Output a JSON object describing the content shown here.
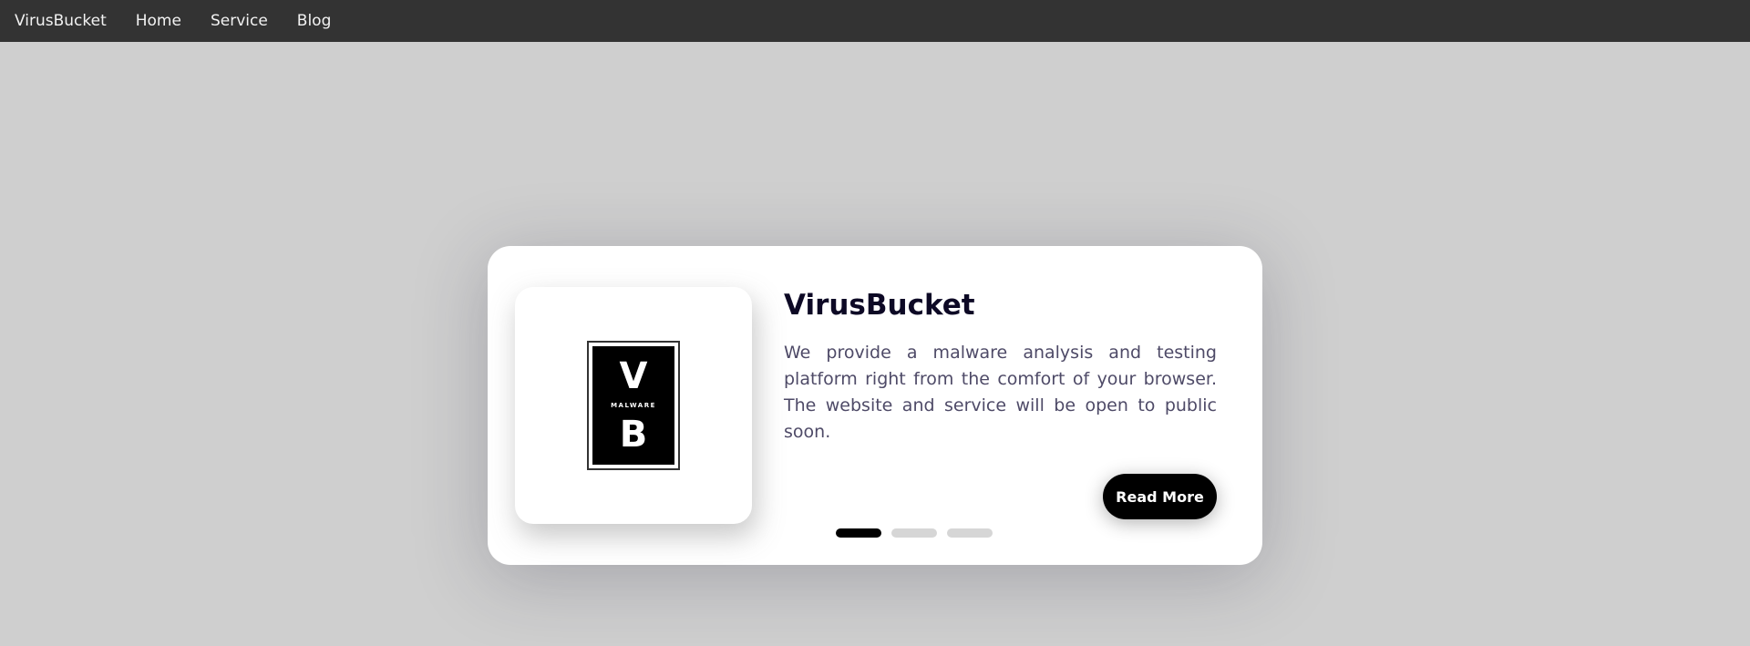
{
  "nav": {
    "items": [
      {
        "label": "VirusBucket"
      },
      {
        "label": "Home"
      },
      {
        "label": "Service"
      },
      {
        "label": "Blog"
      }
    ]
  },
  "slide": {
    "logo": {
      "letter_top": "V",
      "word": "MALWARE",
      "letter_bottom": "B"
    },
    "title": "VirusBucket",
    "text": "We provide a malware analysis and testing platform right from the comfort of your browser. The website and service will be open to public soon.",
    "button_label": "Read More"
  },
  "pagination": {
    "total": 3,
    "active": 1
  },
  "colors": {
    "nav_bg": "#333333",
    "page_bg": "#cfcfcf",
    "title": "#0d0925",
    "text": "#4e4a67",
    "button": "#000000",
    "dot_active": "#000000",
    "dot_inactive": "#d6d6d6"
  }
}
